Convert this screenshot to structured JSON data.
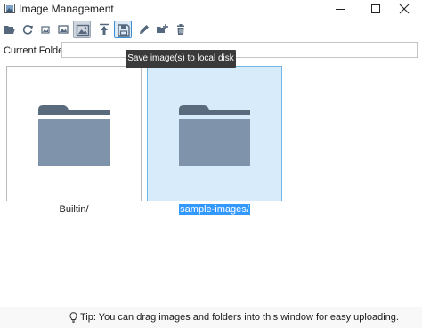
{
  "window": {
    "title": "Image Management",
    "controls": [
      "minimize",
      "maximize",
      "close"
    ]
  },
  "toolbar": {
    "buttons": [
      {
        "name": "open-folder-button",
        "icon": "folder-open-icon",
        "state": "normal"
      },
      {
        "name": "refresh-button",
        "icon": "refresh-icon",
        "state": "normal"
      },
      {
        "name": "small-thumbnails-button",
        "icon": "image-small-icon",
        "state": "normal"
      },
      {
        "name": "medium-thumbnails-button",
        "icon": "image-medium-icon",
        "state": "normal"
      },
      {
        "name": "large-thumbnails-button",
        "icon": "image-large-icon",
        "state": "pressed"
      },
      {
        "name": "upload-button",
        "icon": "upload-icon",
        "state": "normal"
      },
      {
        "name": "save-button",
        "icon": "save-icon",
        "state": "focused"
      },
      {
        "name": "rename-button",
        "icon": "pencil-icon",
        "state": "normal"
      },
      {
        "name": "new-folder-button",
        "icon": "folder-add-icon",
        "state": "normal"
      },
      {
        "name": "delete-button",
        "icon": "trash-icon",
        "state": "normal"
      }
    ]
  },
  "current_folder": {
    "label": "Current Folder",
    "value": ""
  },
  "tooltip": {
    "text": "Save image(s) to local disk"
  },
  "items": [
    {
      "label": "Builtin/",
      "type": "folder",
      "selected": false
    },
    {
      "label": "sample-images/",
      "type": "folder",
      "selected": true
    }
  ],
  "status": {
    "tip": "Tip: You can drag images and folders into this window for easy uploading."
  },
  "colors": {
    "folder": "#7f93ab",
    "folder_tab": "#5b6b7e",
    "selection_fill": "#d7ebfa",
    "selection_border": "#6fb8e6",
    "label_highlight": "#3399ff",
    "tooltip_bg": "#3a3a3a"
  }
}
